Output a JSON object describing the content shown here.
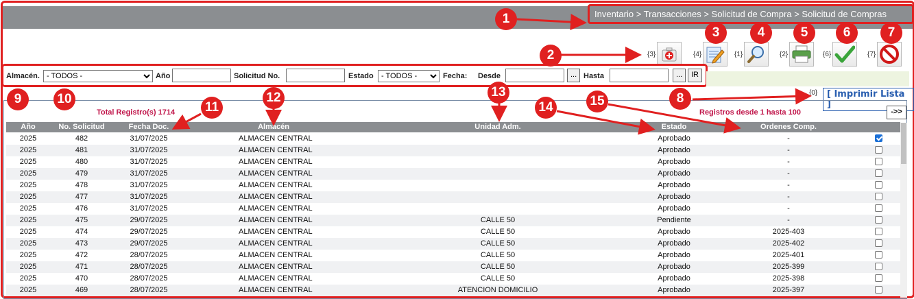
{
  "breadcrumb": "Inventario > Transacciones > Solicitud de Compra > Solicitud de Compras",
  "toolbar": [
    {
      "count": "{3}",
      "icon": "add-medkit-icon"
    },
    {
      "count": "{4}",
      "icon": "edit-pencil-icon"
    },
    {
      "count": "{1}",
      "icon": "magnifier-icon"
    },
    {
      "count": "{2}",
      "icon": "printer-icon"
    },
    {
      "count": "{6}",
      "icon": "checkmark-icon"
    },
    {
      "count": "{7}",
      "icon": "cancel-icon"
    }
  ],
  "filters": {
    "almacen_label": "Almacén.",
    "almacen_value": "- TODOS -",
    "anio_label": "Año",
    "solicitud_label": "Solicitud No.",
    "estado_label": "Estado",
    "estado_value": "- TODOS -",
    "fecha_label": "Fecha:",
    "desde_label": "Desde",
    "hasta_label": "Hasta",
    "dots": "...",
    "ir": "IR"
  },
  "print": {
    "count": "{0}",
    "label": "[ Imprimir Lista ]"
  },
  "grid": {
    "total": "Total Registro(s) 1714",
    "range": "Registros desde 1 hasta 100",
    "next": "->>",
    "headers": [
      "Año",
      "No. Solicitud",
      "Fecha Doc.",
      "Almacén",
      "Unidad Adm.",
      "Estado",
      "Ordenes Comp."
    ],
    "rows": [
      [
        "2025",
        "482",
        "31/07/2025",
        "ALMACEN CENTRAL",
        "",
        "Aprobado",
        "-",
        true
      ],
      [
        "2025",
        "481",
        "31/07/2025",
        "ALMACEN CENTRAL",
        "",
        "Aprobado",
        "-",
        false
      ],
      [
        "2025",
        "480",
        "31/07/2025",
        "ALMACEN CENTRAL",
        "",
        "Aprobado",
        "-",
        false
      ],
      [
        "2025",
        "479",
        "31/07/2025",
        "ALMACEN CENTRAL",
        "",
        "Aprobado",
        "-",
        false
      ],
      [
        "2025",
        "478",
        "31/07/2025",
        "ALMACEN CENTRAL",
        "",
        "Aprobado",
        "-",
        false
      ],
      [
        "2025",
        "477",
        "31/07/2025",
        "ALMACEN CENTRAL",
        "",
        "Aprobado",
        "-",
        false
      ],
      [
        "2025",
        "476",
        "31/07/2025",
        "ALMACEN CENTRAL",
        "",
        "Aprobado",
        "-",
        false
      ],
      [
        "2025",
        "475",
        "29/07/2025",
        "ALMACEN CENTRAL",
        "CALLE 50",
        "Pendiente",
        "-",
        false
      ],
      [
        "2025",
        "474",
        "29/07/2025",
        "ALMACEN CENTRAL",
        "CALLE 50",
        "Aprobado",
        "2025-403",
        false
      ],
      [
        "2025",
        "473",
        "29/07/2025",
        "ALMACEN CENTRAL",
        "CALLE 50",
        "Aprobado",
        "2025-402",
        false
      ],
      [
        "2025",
        "472",
        "28/07/2025",
        "ALMACEN CENTRAL",
        "CALLE 50",
        "Aprobado",
        "2025-401",
        false
      ],
      [
        "2025",
        "471",
        "28/07/2025",
        "ALMACEN CENTRAL",
        "CALLE 50",
        "Aprobado",
        "2025-399",
        false
      ],
      [
        "2025",
        "470",
        "28/07/2025",
        "ALMACEN CENTRAL",
        "CALLE 50",
        "Aprobado",
        "2025-398",
        false
      ],
      [
        "2025",
        "469",
        "28/07/2025",
        "ALMACEN CENTRAL",
        "ATENCION DOMICILIO",
        "Aprobado",
        "2025-397",
        false
      ]
    ]
  },
  "callouts": [
    "1",
    "2",
    "3",
    "4",
    "5",
    "6",
    "7",
    "8",
    "9",
    "10",
    "11",
    "12",
    "13",
    "14",
    "15"
  ],
  "colors": {
    "callout": "#e02020",
    "header_bar": "#8b8e91",
    "link": "#2a5fb0",
    "highlight_text": "#c0154a"
  }
}
